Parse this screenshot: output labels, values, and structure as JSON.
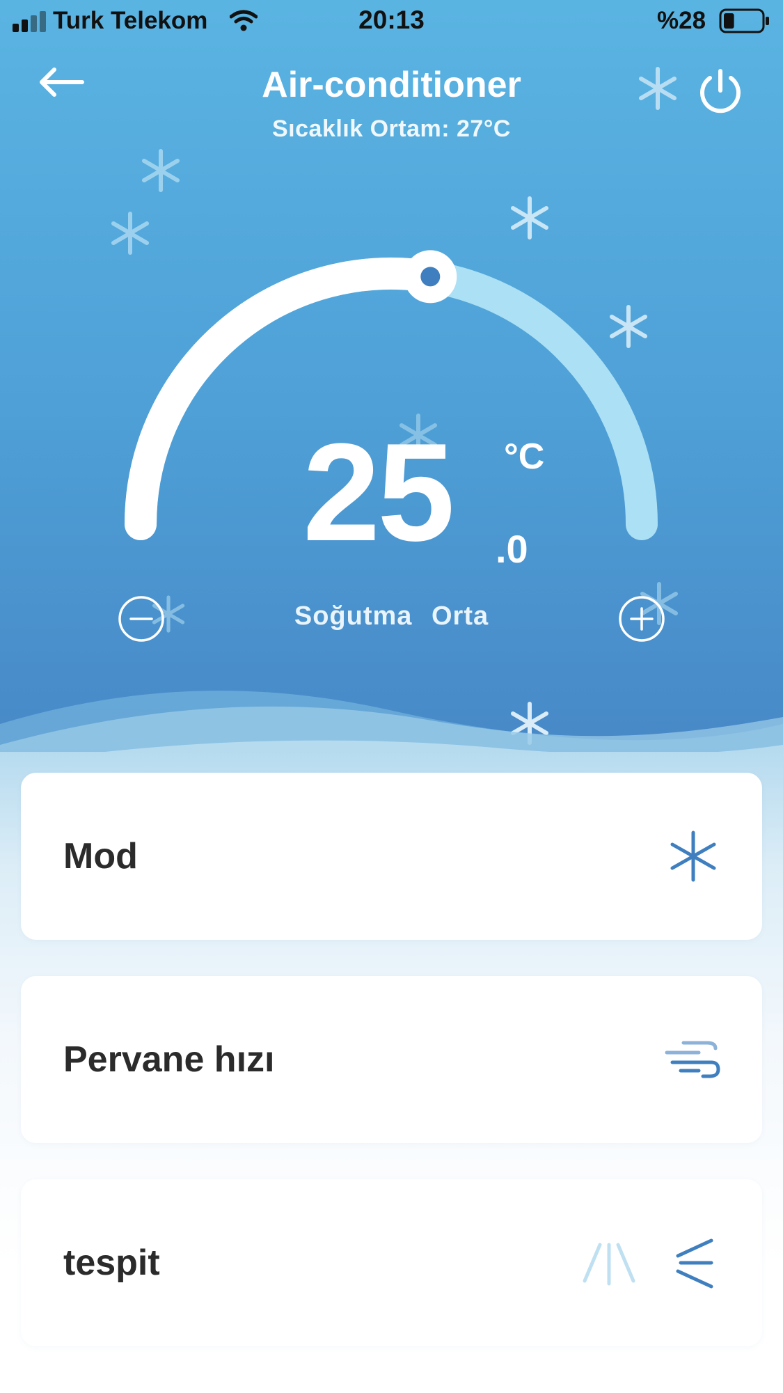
{
  "status_bar": {
    "carrier": "Turk Telekom",
    "time": "20:13",
    "battery": "%28",
    "battery_level": 0.28
  },
  "header": {
    "title": "Air-conditioner",
    "subtitle": "Sıcaklık Ortam: 27°C",
    "back_icon": "arrow-left-icon",
    "power_icon": "power-icon"
  },
  "thermostat": {
    "temperature": "25",
    "decimal": ".0",
    "unit": "°C",
    "setpoint_fraction": 0.55,
    "minus_icon": "minus-circle-icon",
    "plus_icon": "plus-circle-icon",
    "mode": "Soğutma",
    "fan": "Orta"
  },
  "cards": {
    "mode": {
      "label": "Mod",
      "icon": "snowflake-icon"
    },
    "fan_speed": {
      "label": "Pervane hızı",
      "icon": "wind-icon"
    },
    "swing": {
      "label": "tespit",
      "icons": [
        "swing-fan-icon",
        "swing-direction-icon"
      ]
    }
  },
  "colors": {
    "accent": "#3f7fbf",
    "hero_top": "#5ab4e2",
    "hero_bottom": "#4787c6"
  }
}
